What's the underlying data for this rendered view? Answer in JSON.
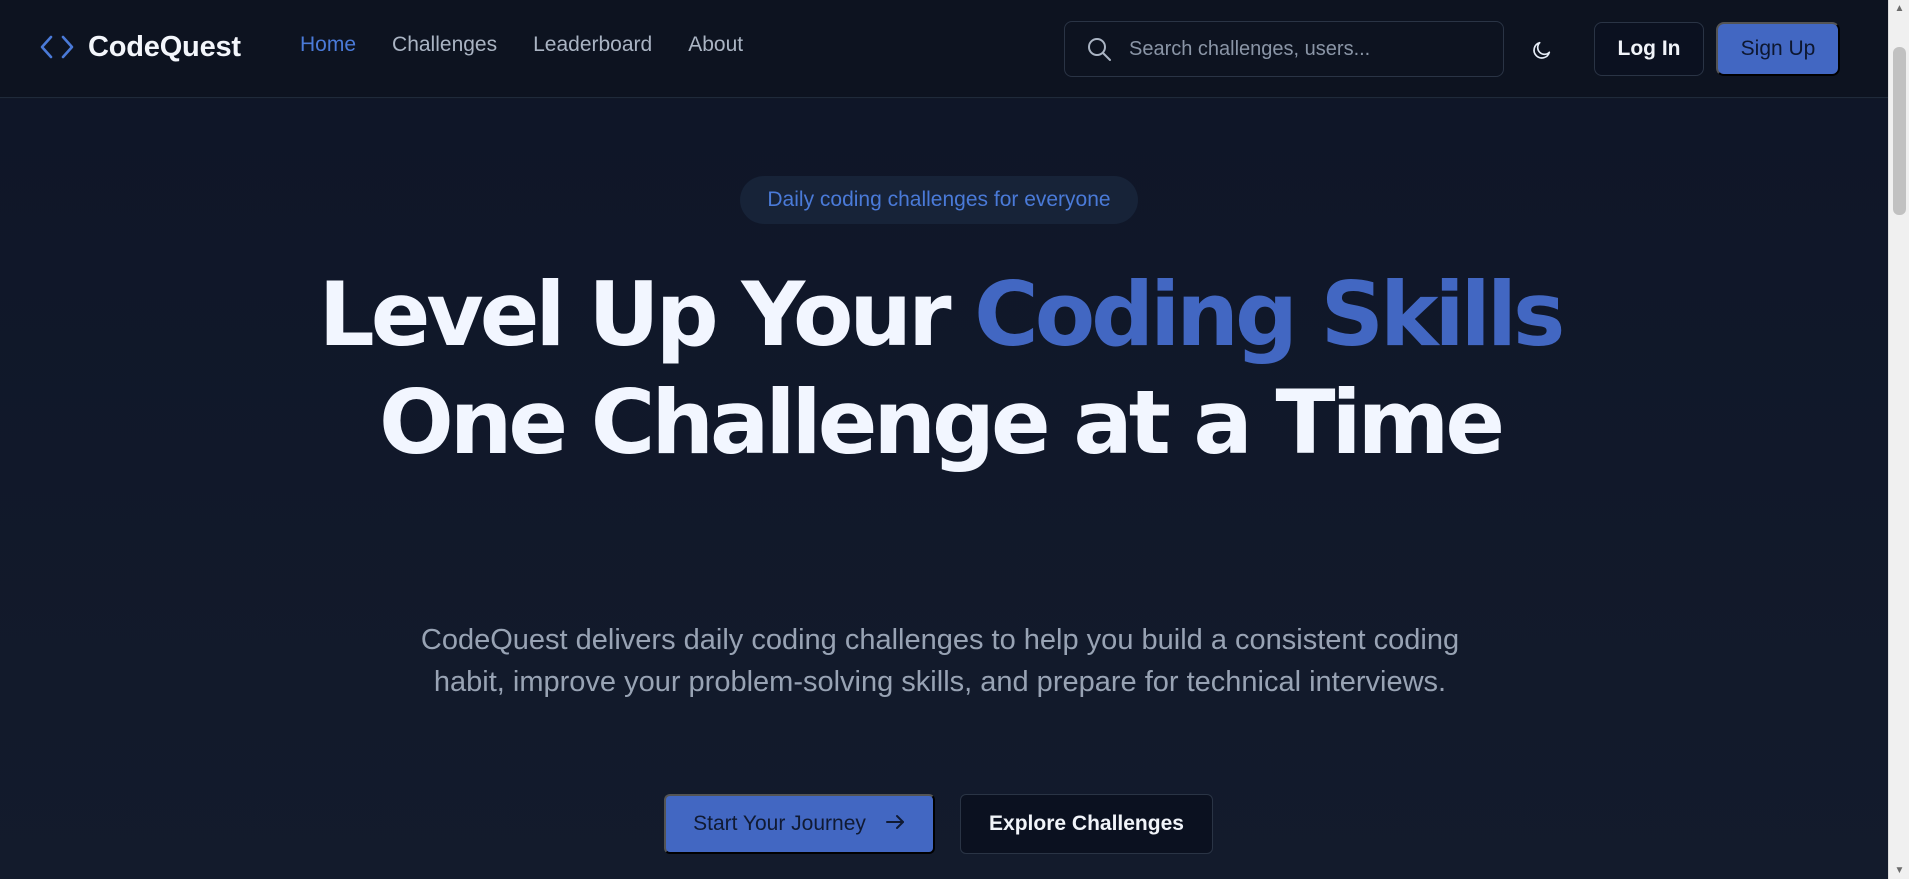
{
  "brand": {
    "name": "CodeQuest",
    "icon": "code-brackets-icon",
    "accent_color": "#4a7ad8"
  },
  "nav": {
    "links": [
      {
        "label": "Home",
        "active": true
      },
      {
        "label": "Challenges",
        "active": false
      },
      {
        "label": "Leaderboard",
        "active": false
      },
      {
        "label": "About",
        "active": false
      }
    ]
  },
  "search": {
    "placeholder": "Search challenges, users...",
    "value": "",
    "icon": "search-icon"
  },
  "header_actions": {
    "theme_icon": "moon-icon",
    "login_label": "Log In",
    "signup_label": "Sign Up"
  },
  "hero": {
    "badge": "Daily coding challenges for everyone",
    "headline": {
      "part1": "Level Up Your ",
      "accent": "Coding Skills",
      "part2": " One Challenge at a Time"
    },
    "description": "CodeQuest delivers daily coding challenges to help you build a consistent coding habit, improve your problem-solving skills, and prepare for technical interviews.",
    "primary_cta": "Start Your Journey",
    "primary_cta_icon": "arrow-right-icon",
    "secondary_cta": "Explore Challenges"
  },
  "colors": {
    "background": "#111827",
    "primary": "#4267c2",
    "text": "#f2f6ff",
    "muted": "#98a3b4"
  }
}
